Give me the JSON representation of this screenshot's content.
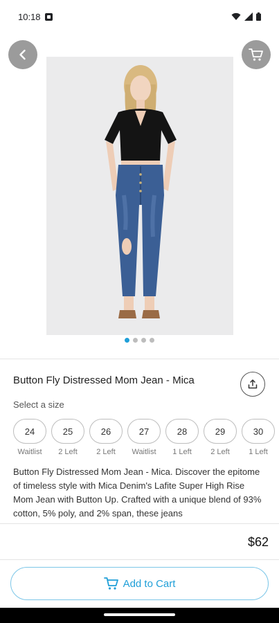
{
  "status_bar": {
    "time": "10:18",
    "icons": [
      "notification-icon",
      "wifi-icon",
      "signal-icon",
      "battery-icon"
    ]
  },
  "header": {
    "back_icon": "chevron-left-icon",
    "cart_icon": "cart-icon"
  },
  "carousel": {
    "image_count": 4,
    "active_index": 0
  },
  "product": {
    "title": "Button Fly Distressed Mom Jean - Mica",
    "share_icon": "share-icon",
    "size_label": "Select a size",
    "sizes": [
      {
        "size": "24",
        "availability": "Waitlist"
      },
      {
        "size": "25",
        "availability": "2 Left"
      },
      {
        "size": "26",
        "availability": "2 Left"
      },
      {
        "size": "27",
        "availability": "Waitlist"
      },
      {
        "size": "28",
        "availability": "1 Left"
      },
      {
        "size": "29",
        "availability": "2 Left"
      },
      {
        "size": "30",
        "availability": "1 Left"
      }
    ],
    "description": "Button Fly Distressed Mom Jean - Mica. Discover the epitome of timeless style with Mica Denim's Lafite Super High Rise Mom Jean with Button Up. Crafted with a unique blend of 93% cotton, 5% poly, and 2% span, these jeans",
    "price": "$62"
  },
  "footer": {
    "add_to_cart_label": "Add to Cart",
    "add_to_cart_icon": "cart-icon"
  },
  "colors": {
    "accent": "#1f9fd8",
    "button_border": "#7bc6e8",
    "overlay_button": "#9b9b9b"
  }
}
